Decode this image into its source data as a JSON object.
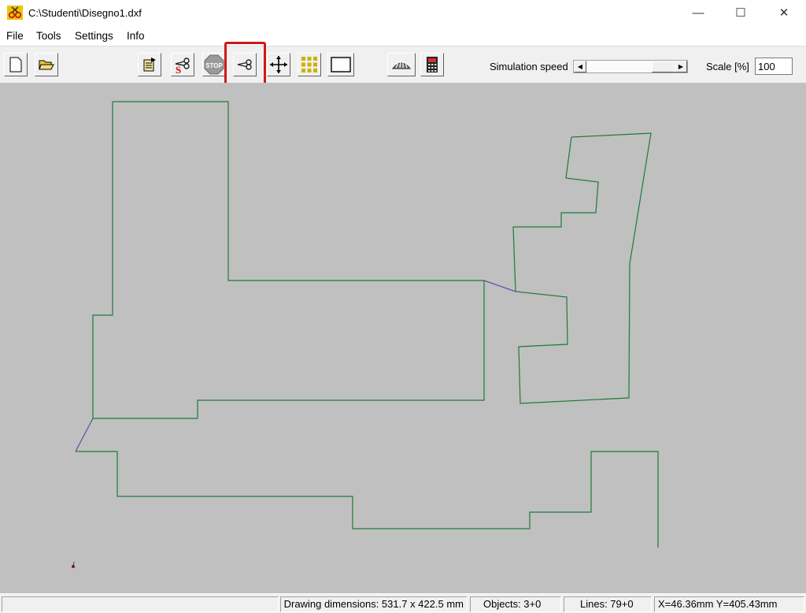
{
  "window": {
    "title": "C:\\Studenti\\Disegno1.dxf",
    "minimize_glyph": "—",
    "maximize_glyph": "☐",
    "close_glyph": "✕"
  },
  "menu": {
    "items": [
      "File",
      "Tools",
      "Settings",
      "Info"
    ]
  },
  "toolbar": {
    "buttons": [
      {
        "name": "new-file-button",
        "icon": "new-document-icon"
      },
      {
        "name": "open-file-button",
        "icon": "open-folder-icon"
      },
      {
        "name": "export-button",
        "icon": "export-document-icon"
      },
      {
        "name": "simulate-cut-button",
        "icon": "scissors-s-icon"
      },
      {
        "name": "stop-button",
        "icon": "stop-sign-icon",
        "label": "STOP"
      },
      {
        "name": "cut-button",
        "icon": "scissors-icon"
      },
      {
        "name": "move-button",
        "icon": "move-arrows-icon"
      },
      {
        "name": "grid-button",
        "icon": "grid-icon"
      },
      {
        "name": "frame-button",
        "icon": "rectangle-icon"
      },
      {
        "name": "machine-button",
        "icon": "machine-icon"
      },
      {
        "name": "calculator-button",
        "icon": "calculator-icon"
      }
    ],
    "simulation_speed_label": "Simulation speed",
    "simulation_speed_level": 0.92,
    "scale_label": "Scale [%]",
    "scale_value": "100"
  },
  "colors": {
    "cut_path": "#1e7a3c",
    "travel_path": "#5a4fa8",
    "canvas_bg": "#c0c0c0",
    "highlight": "#d01818"
  },
  "status": {
    "field1": "",
    "drawing_dimensions": "Drawing dimensions: 531.7 x 422.5 mm",
    "objects": "Objects: 3+0",
    "lines": "Lines: 79+0",
    "coordinates": "X=46.36mm Y=405.43mm"
  }
}
